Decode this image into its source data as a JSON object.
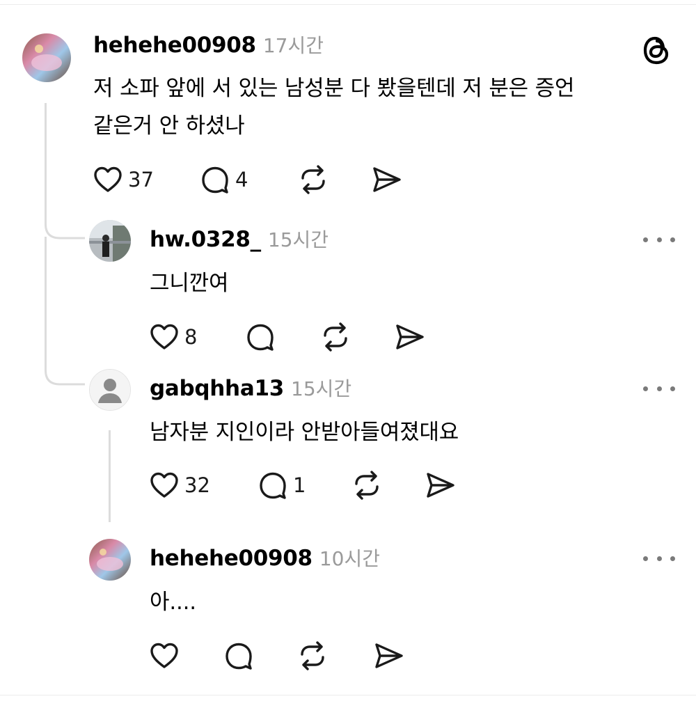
{
  "comments": [
    {
      "username": "hehehe00908",
      "time": "17시간",
      "text_lines": [
        "저 소파 앞에 서 있는 남성분 다 봤을텐데 저 분은 증언",
        "같은거 안 하셨나"
      ],
      "likes": "37",
      "replies": "4"
    },
    {
      "username": "hw.0328_",
      "time": "15시간",
      "text_lines": [
        "그니깐여"
      ],
      "likes": "8",
      "replies": ""
    },
    {
      "username": "gabqhha13",
      "time": "15시간",
      "text_lines": [
        "남자분 지인이라 안받아들여졌대요"
      ],
      "likes": "32",
      "replies": "1"
    },
    {
      "username": "hehehe00908",
      "time": "10시간",
      "text_lines": [
        "아...."
      ],
      "likes": "",
      "replies": ""
    }
  ],
  "colors": {
    "text": "#000000",
    "muted": "#9a9a9a",
    "thread_line": "#dcdcdc"
  },
  "icons": {
    "app_logo": "threads-logo-icon",
    "like": "heart-icon",
    "reply": "comment-bubble-icon",
    "repost": "repost-icon",
    "share": "send-icon",
    "more": "more-options-icon"
  }
}
